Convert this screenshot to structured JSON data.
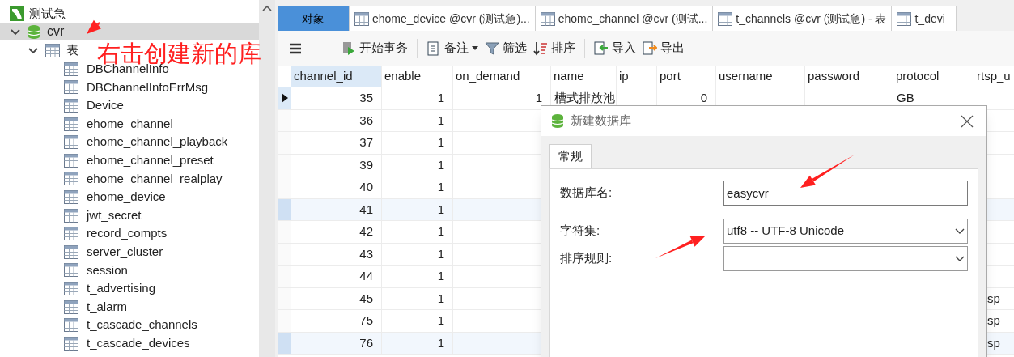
{
  "tree": {
    "connection": "测试急",
    "database": {
      "label": "cvr",
      "expanded": true,
      "selected": true
    },
    "group": {
      "label": "表",
      "expanded": true
    },
    "tables": [
      "DBChannelInfo",
      "DBChannelInfoErrMsg",
      "Device",
      "ehome_channel",
      "ehome_channel_playback",
      "ehome_channel_preset",
      "ehome_channel_realplay",
      "ehome_device",
      "jwt_secret",
      "record_compts",
      "server_cluster",
      "session",
      "t_advertising",
      "t_alarm",
      "t_cascade_channels",
      "t_cascade_devices"
    ]
  },
  "tabs": [
    {
      "label": "对象",
      "selected": true,
      "kind": "objects"
    },
    {
      "label": "ehome_device @cvr (测试急)...",
      "selected": false,
      "kind": "table"
    },
    {
      "label": "ehome_channel @cvr (测试...",
      "selected": false,
      "kind": "table"
    },
    {
      "label": "t_channels @cvr (测试急) - 表",
      "selected": false,
      "kind": "table"
    },
    {
      "label": "t_devi",
      "selected": false,
      "kind": "table"
    }
  ],
  "toolbar": [
    {
      "kind": "menu"
    },
    {
      "kind": "transaction",
      "label": "开始事务"
    },
    {
      "kind": "note",
      "label": "备注"
    },
    {
      "kind": "filter",
      "label": "筛选"
    },
    {
      "kind": "sort",
      "label": "排序"
    },
    {
      "kind": "import",
      "label": "导入"
    },
    {
      "kind": "export",
      "label": "导出"
    }
  ],
  "table": {
    "columns": [
      {
        "label": "channel_id",
        "selected": true
      },
      {
        "label": "enable",
        "selected": false
      },
      {
        "label": "on_demand",
        "selected": false
      },
      {
        "label": "name",
        "selected": false
      },
      {
        "label": "ip",
        "selected": false
      },
      {
        "label": "port",
        "selected": false
      },
      {
        "label": "username",
        "selected": false
      },
      {
        "label": "password",
        "selected": false
      },
      {
        "label": "protocol",
        "selected": false
      },
      {
        "label": "rtsp_u",
        "selected": false
      }
    ],
    "rows": [
      {
        "current": true,
        "highlight": false,
        "cells": [
          "35",
          "1",
          "1",
          "槽式排放池",
          "",
          "0",
          "",
          "",
          "GB",
          ""
        ]
      },
      {
        "current": false,
        "highlight": false,
        "cells": [
          "36",
          "1",
          "",
          "",
          "",
          "",
          "",
          "",
          "",
          ""
        ]
      },
      {
        "current": false,
        "highlight": false,
        "cells": [
          "37",
          "1",
          "",
          "",
          "",
          "",
          "",
          "",
          "",
          ""
        ]
      },
      {
        "current": false,
        "highlight": false,
        "cells": [
          "39",
          "1",
          "",
          "",
          "",
          "",
          "",
          "",
          "",
          ""
        ]
      },
      {
        "current": false,
        "highlight": false,
        "cells": [
          "40",
          "1",
          "",
          "",
          "",
          "",
          "",
          "",
          "",
          ""
        ]
      },
      {
        "current": false,
        "highlight": true,
        "cells": [
          "41",
          "1",
          "",
          "",
          "",
          "",
          "",
          "",
          "",
          ""
        ]
      },
      {
        "current": false,
        "highlight": false,
        "cells": [
          "42",
          "1",
          "",
          "",
          "",
          "",
          "",
          "",
          "",
          ""
        ]
      },
      {
        "current": false,
        "highlight": false,
        "cells": [
          "43",
          "1",
          "",
          "",
          "",
          "",
          "",
          "",
          "",
          ""
        ]
      },
      {
        "current": false,
        "highlight": false,
        "cells": [
          "44",
          "1",
          "",
          "",
          "",
          "",
          "",
          "",
          "",
          ""
        ]
      },
      {
        "current": false,
        "highlight": false,
        "cells": [
          "45",
          "1",
          "",
          "",
          "",
          "",
          "",
          "",
          "",
          "sp"
        ]
      },
      {
        "current": false,
        "highlight": false,
        "cells": [
          "75",
          "1",
          "",
          "",
          "",
          "",
          "",
          "",
          "",
          "sp"
        ]
      },
      {
        "current": false,
        "highlight": true,
        "cells": [
          "76",
          "1",
          "",
          "",
          "",
          "",
          "",
          "",
          "",
          "sp"
        ]
      }
    ]
  },
  "dialog": {
    "title": "新建数据库",
    "tabs": [
      {
        "label": "常规",
        "selected": true
      }
    ],
    "fields": [
      {
        "kind": "text",
        "label": "数据库名:",
        "value": "easycvr"
      },
      {
        "kind": "select",
        "label": "字符集:",
        "value": "utf8 -- UTF-8 Unicode"
      },
      {
        "kind": "select",
        "label": "排序规则:"
      }
    ]
  },
  "annotation": {
    "text": "右击创建新的库"
  }
}
